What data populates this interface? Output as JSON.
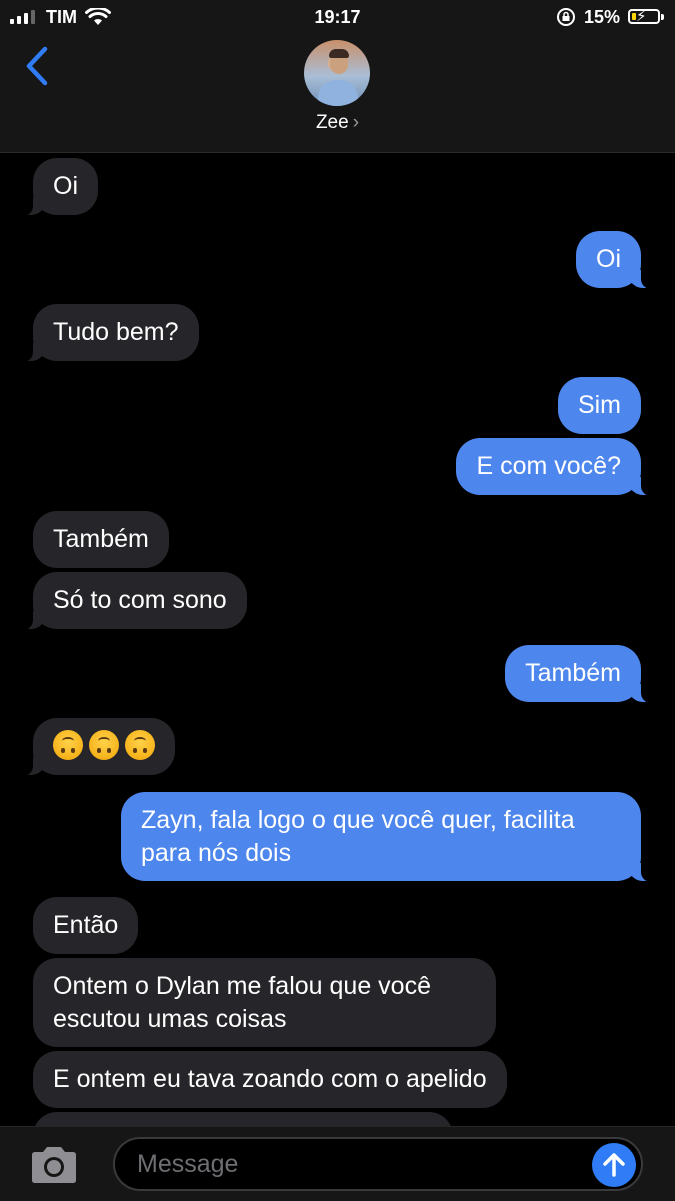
{
  "status_bar": {
    "carrier": "TIM",
    "time": "19:17",
    "battery_percent_text": "15%",
    "battery_level": 0.15
  },
  "header": {
    "contact_name": "Zee",
    "chevron": "›"
  },
  "messages": [
    {
      "from": "them",
      "text": "Oi"
    },
    {
      "from": "me",
      "text": "Oi"
    },
    {
      "from": "them",
      "text": "Tudo bem?"
    },
    {
      "from": "me",
      "text": "Sim"
    },
    {
      "from": "me",
      "text": "E com você?"
    },
    {
      "from": "them",
      "text": "Também"
    },
    {
      "from": "them",
      "text": "Só to com sono"
    },
    {
      "from": "me",
      "text": "Também"
    },
    {
      "from": "them",
      "text": "🙃🙃🙃"
    },
    {
      "from": "me",
      "text": "Zayn, fala logo o que você quer, facilita para nós dois"
    },
    {
      "from": "them",
      "text": "Então"
    },
    {
      "from": "them",
      "text": "Ontem o Dylan me falou que você escutou umas coisas"
    },
    {
      "from": "them",
      "text": "E ontem eu tava zoando com o apelido"
    }
  ],
  "composer": {
    "placeholder": "Message"
  },
  "colors": {
    "outgoing_bubble": "#4d86ec",
    "incoming_bubble": "#26262a",
    "send_button": "#2f7cf6",
    "battery_fill": "#ffd60a"
  },
  "icons": [
    "back-chevron-icon",
    "camera-icon",
    "send-arrow-icon",
    "wifi-icon",
    "signal-icon",
    "rotation-lock-icon",
    "battery-icon"
  ]
}
